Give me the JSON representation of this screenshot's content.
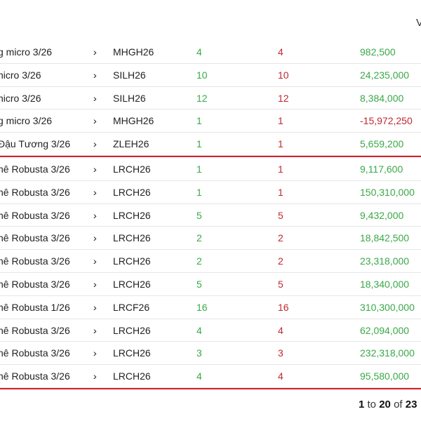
{
  "header": {
    "partial_label": "V"
  },
  "groups": [
    {
      "rows": [
        {
          "name": "g micro 3/26",
          "symbol": "MHGH26",
          "buy": "4",
          "sell": "4",
          "value": "982,500",
          "negative": false
        },
        {
          "name": "nicro 3/26",
          "symbol": "SILH26",
          "buy": "10",
          "sell": "10",
          "value": "24,235,000",
          "negative": false
        },
        {
          "name": "nicro 3/26",
          "symbol": "SILH26",
          "buy": "12",
          "sell": "12",
          "value": "8,384,000",
          "negative": false
        },
        {
          "name": "g micro 3/26",
          "symbol": "MHGH26",
          "buy": "1",
          "sell": "1",
          "value": "-15,972,250",
          "negative": true
        },
        {
          "name": "Đậu Tương 3/26",
          "symbol": "ZLEH26",
          "buy": "1",
          "sell": "1",
          "value": "5,659,200",
          "negative": false
        }
      ]
    },
    {
      "rows": [
        {
          "name": "hê Robusta 3/26",
          "symbol": "LRCH26",
          "buy": "1",
          "sell": "1",
          "value": "9,117,600",
          "negative": false
        },
        {
          "name": "hê Robusta 3/26",
          "symbol": "LRCH26",
          "buy": "1",
          "sell": "1",
          "value": "150,310,000",
          "negative": false
        },
        {
          "name": "hê Robusta 3/26",
          "symbol": "LRCH26",
          "buy": "5",
          "sell": "5",
          "value": "9,432,000",
          "negative": false
        },
        {
          "name": "hê Robusta 3/26",
          "symbol": "LRCH26",
          "buy": "2",
          "sell": "2",
          "value": "18,842,500",
          "negative": false
        },
        {
          "name": "hê Robusta 3/26",
          "symbol": "LRCH26",
          "buy": "2",
          "sell": "2",
          "value": "23,318,000",
          "negative": false
        },
        {
          "name": "hê Robusta 3/26",
          "symbol": "LRCH26",
          "buy": "5",
          "sell": "5",
          "value": "18,340,000",
          "negative": false
        },
        {
          "name": "hê Robusta 1/26",
          "symbol": "LRCF26",
          "buy": "16",
          "sell": "16",
          "value": "310,300,000",
          "negative": false
        },
        {
          "name": "hê Robusta 3/26",
          "symbol": "LRCH26",
          "buy": "4",
          "sell": "4",
          "value": "62,094,000",
          "negative": false
        },
        {
          "name": "hê Robusta 3/26",
          "symbol": "LRCH26",
          "buy": "3",
          "sell": "3",
          "value": "232,318,000",
          "negative": false
        },
        {
          "name": "hê Robusta 3/26",
          "symbol": "LRCH26",
          "buy": "4",
          "sell": "4",
          "value": "95,580,000",
          "negative": false
        }
      ]
    }
  ],
  "chevron": "›",
  "pagination": {
    "from": "1",
    "to_word": "to",
    "to": "20",
    "of_word": "of",
    "total": "23"
  }
}
